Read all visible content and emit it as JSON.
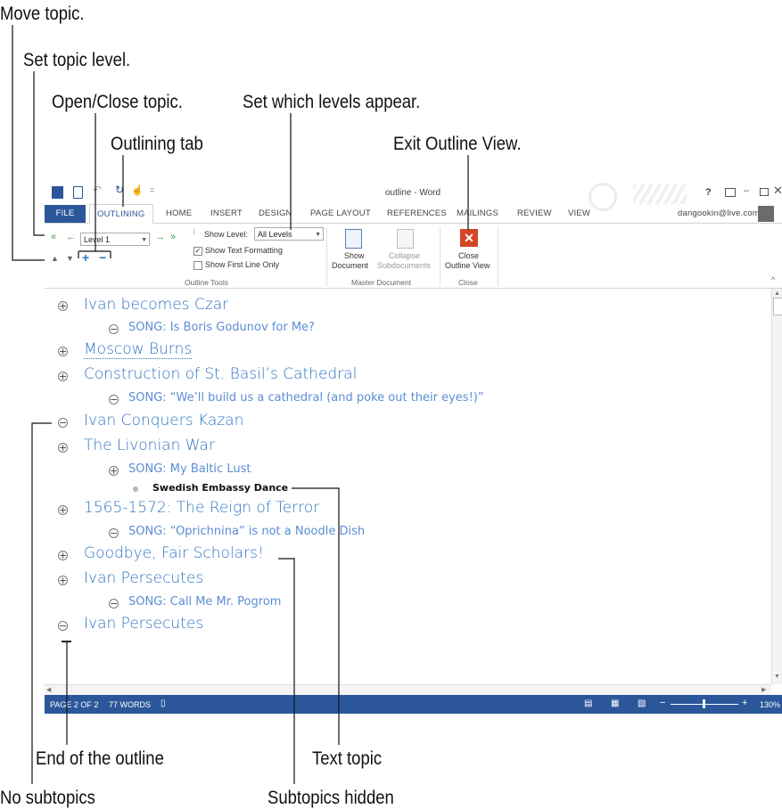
{
  "callouts": {
    "move_topic": "Move topic.",
    "set_topic_level": "Set topic level.",
    "open_close_topic": "Open/Close topic.",
    "set_levels": "Set which levels appear.",
    "outlining_tab": "Outlining tab",
    "exit_outline": "Exit Outline View.",
    "end_outline": "End of the outline",
    "text_topic": "Text topic",
    "no_subtopics": "No subtopics",
    "subtopics_hidden": "Subtopics hidden"
  },
  "window": {
    "title": "outline - Word",
    "help": "?",
    "account": "dangookin@live.com"
  },
  "tabs": [
    "FILE",
    "OUTLINING",
    "HOME",
    "INSERT",
    "DESIGN",
    "PAGE LAYOUT",
    "REFERENCES",
    "MAILINGS",
    "REVIEW",
    "VIEW"
  ],
  "ribbon": {
    "level_value": "Level 1",
    "show_level_label": "Show Level:",
    "show_level_value": "All Levels",
    "show_text_formatting": "Show Text Formatting",
    "show_first_line_only": "Show First Line Only",
    "outline_tools": "Outline Tools",
    "show_document_1": "Show",
    "show_document_2": "Document",
    "collapse_1": "Collapse",
    "collapse_2": "Subdocuments",
    "master_document": "Master Document",
    "close_1": "Close",
    "close_2": "Outline View",
    "close_group": "Close"
  },
  "outline": [
    {
      "level": 1,
      "symbol": "plus",
      "text": "Ivan becomes Czar"
    },
    {
      "level": 2,
      "symbol": "minus",
      "text": "SONG: Is Boris Godunov for Me?"
    },
    {
      "level": 1,
      "symbol": "plus",
      "text": "Moscow Burns"
    },
    {
      "level": 1,
      "symbol": "plus",
      "text": "Construction of St. Basil’s Cathedral"
    },
    {
      "level": 2,
      "symbol": "minus",
      "text": "SONG: “We’ll build us a cathedral (and poke out their eyes!)”"
    },
    {
      "level": 1,
      "symbol": "minus",
      "text": "Ivan Conquers Kazan"
    },
    {
      "level": 1,
      "symbol": "plus",
      "text": "The Livonian War"
    },
    {
      "level": 2,
      "symbol": "plus",
      "text": "SONG: My Baltic Lust"
    },
    {
      "level": 3,
      "symbol": "dot",
      "text": "Swedish Embassy Dance"
    },
    {
      "level": 1,
      "symbol": "plus",
      "text": "1565-1572: The Reign of Terror"
    },
    {
      "level": 2,
      "symbol": "minus",
      "text": "SONG: “Oprichnina” is not a Noodle Dish"
    },
    {
      "level": 1,
      "symbol": "plus",
      "text": "Goodbye, Fair Scholars!"
    },
    {
      "level": 1,
      "symbol": "plus",
      "text": "Ivan Persecutes"
    },
    {
      "level": 2,
      "symbol": "minus",
      "text": "SONG: Call Me Mr. Pogrom"
    },
    {
      "level": 1,
      "symbol": "minus",
      "text": "Ivan Persecutes"
    }
  ],
  "status": {
    "page": "PAGE 2 OF 2",
    "words": "77 WORDS",
    "zoom": "130%"
  },
  "colors": {
    "word_blue": "#2b579a",
    "heading_blue": "#2f73c4",
    "close_red": "#d24726"
  }
}
